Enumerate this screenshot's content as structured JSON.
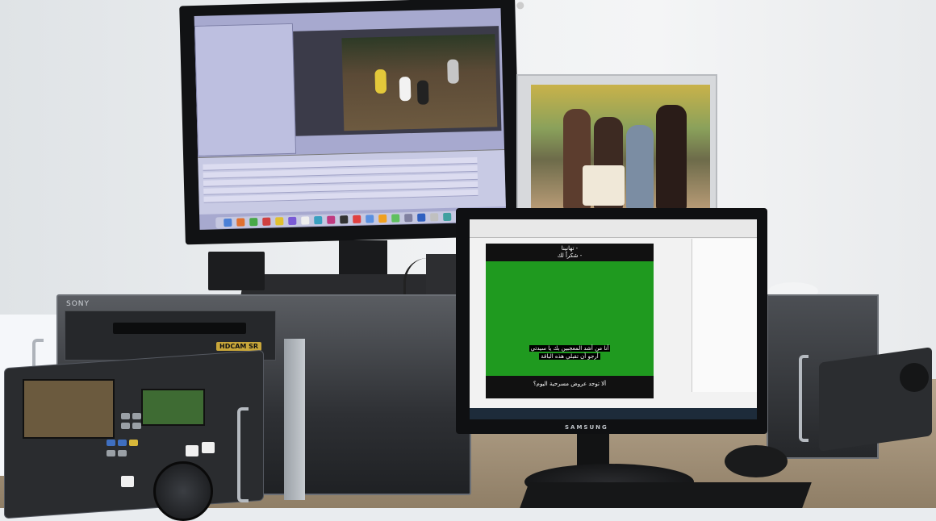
{
  "scene": {
    "deck_brand": "SONY",
    "deck_format_badge": "HDCAM SR",
    "samsung_logo": "SAMSUNG",
    "subtitle_top_1": "تهانينا -",
    "subtitle_top_2": "شكراً لك -",
    "subtitle_mid_1": "أنا من أشد المعجبين بك يا سيدتي",
    "subtitle_mid_2": "أرجو أن تقبلي هذه الباقة",
    "subtitle_bottom": "ألا توجد عروض مسرحية اليوم؟"
  },
  "colors": {
    "editing_ui": "#a7a9cf",
    "green_screen": "#1f9a1f",
    "deck": "#2e3034"
  }
}
